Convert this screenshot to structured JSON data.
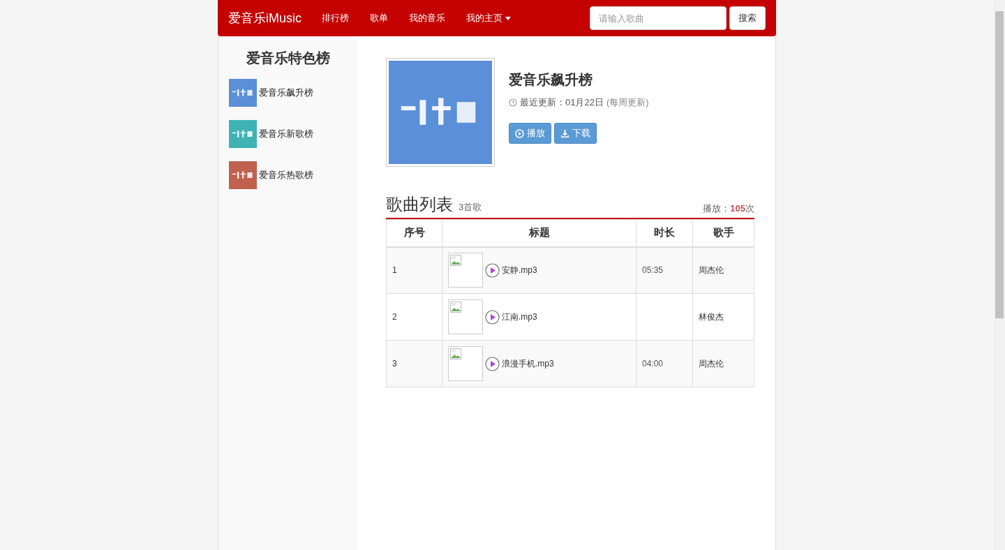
{
  "navbar": {
    "brand": "爱音乐iMusic",
    "links": [
      {
        "label": "排行榜",
        "dropdown": false
      },
      {
        "label": "歌单",
        "dropdown": false
      },
      {
        "label": "我的音乐",
        "dropdown": false
      },
      {
        "label": "我的主页",
        "dropdown": true
      }
    ],
    "search": {
      "placeholder": "请输入歌曲",
      "button": "搜索"
    }
  },
  "sidebar": {
    "title": "爱音乐特色榜",
    "items": [
      {
        "label": "爱音乐飙升榜",
        "color": "#5b8fd8"
      },
      {
        "label": "爱音乐新歌榜",
        "color": "#3fb3b3"
      },
      {
        "label": "爱音乐热歌榜",
        "color": "#c0604e"
      }
    ]
  },
  "chart": {
    "title": "爱音乐飙升榜",
    "updated_label": "最近更新：",
    "updated_date": "01月22日",
    "update_note": "(每周更新)",
    "buttons": [
      {
        "kind": "play",
        "label": "播放"
      },
      {
        "kind": "download",
        "label": "下载"
      }
    ]
  },
  "song_list": {
    "title": "歌曲列表",
    "count": "3首歌",
    "plays_label": "播放：",
    "plays": "105",
    "plays_unit": "次",
    "table": {
      "columns": [
        "序号",
        "标题",
        "时长",
        "歌手"
      ],
      "rows": [
        {
          "index": "1",
          "title": "安静.mp3",
          "duration": "05:35",
          "artist": "周杰伦"
        },
        {
          "index": "2",
          "title": "江南.mp3",
          "artist": "林俊杰"
        },
        {
          "index": "3",
          "title": "浪漫手机.mp3",
          "duration": "04:00",
          "artist": "周杰伦"
        }
      ]
    }
  }
}
